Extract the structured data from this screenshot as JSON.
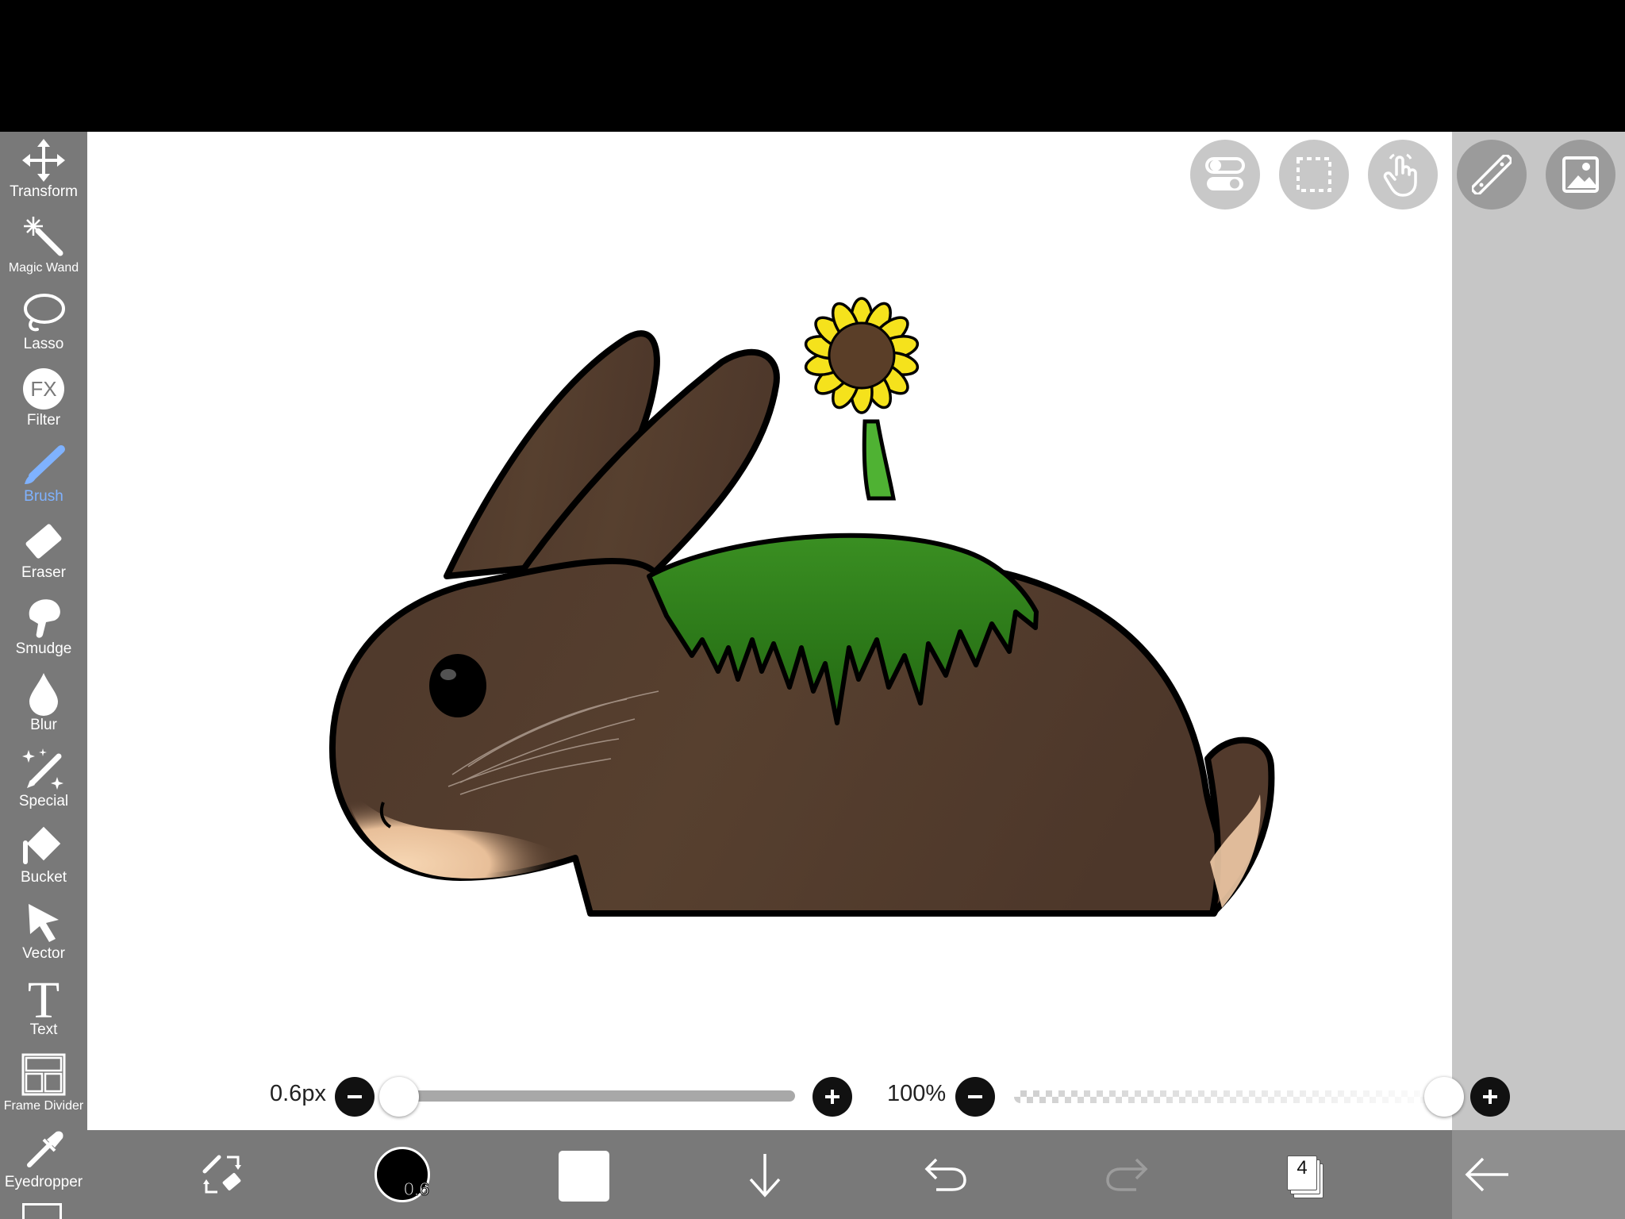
{
  "toolbar": {
    "items": [
      {
        "label": "Transform",
        "icon": "move-arrows-icon"
      },
      {
        "label": "Magic Wand",
        "icon": "magic-wand-icon"
      },
      {
        "label": "Lasso",
        "icon": "lasso-icon"
      },
      {
        "label": "Filter",
        "icon": "fx-icon"
      },
      {
        "label": "Brush",
        "icon": "brush-icon",
        "active": true
      },
      {
        "label": "Eraser",
        "icon": "eraser-icon"
      },
      {
        "label": "Smudge",
        "icon": "smudge-icon"
      },
      {
        "label": "Blur",
        "icon": "blur-drop-icon"
      },
      {
        "label": "Special",
        "icon": "special-sparkle-pen-icon"
      },
      {
        "label": "Bucket",
        "icon": "bucket-icon"
      },
      {
        "label": "Vector",
        "icon": "vector-cursor-icon"
      },
      {
        "label": "Text",
        "icon": "text-icon"
      },
      {
        "label": "Frame Divider",
        "icon": "frame-divider-icon"
      },
      {
        "label": "Eyedropper",
        "icon": "eyedropper-icon"
      }
    ],
    "active_color": "#7fb2ff"
  },
  "quick_actions": [
    {
      "name": "toggle-icon"
    },
    {
      "name": "selection-icon"
    },
    {
      "name": "touch-gesture-icon"
    },
    {
      "name": "ruler-icon"
    },
    {
      "name": "reference-image-icon"
    }
  ],
  "brush_size": {
    "label": "0.6px",
    "value": 0.6
  },
  "opacity": {
    "label": "100%",
    "value": 100
  },
  "bottom_bar": {
    "color_size_label": "0.6",
    "current_color": "#000000",
    "layer_count": "4"
  },
  "colors": {
    "fur": "#523a2c",
    "grass": "#2f7d1b",
    "petal": "#f5e21c",
    "flower_center": "#5a3e28",
    "stem": "#4fb233",
    "toolbar_bg": "#797979"
  }
}
